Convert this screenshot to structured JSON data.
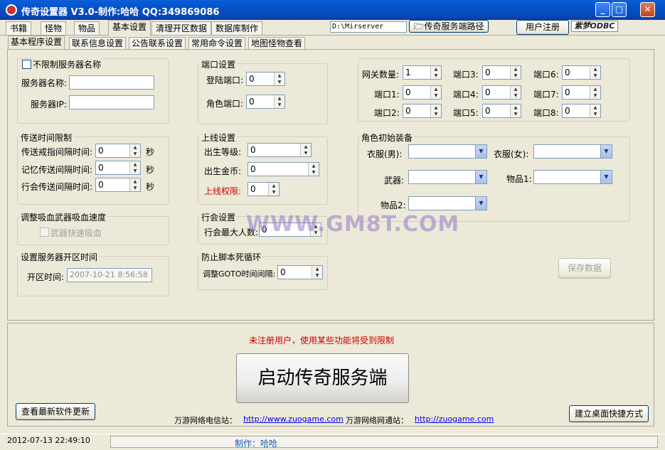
{
  "window": {
    "title": "传奇设置器 V3.0-制作:哈哈 QQ:349869086"
  },
  "top_tabs": [
    "书籍",
    "怪物",
    "物品",
    "基本设置",
    "清理开区数据",
    "数据库制作"
  ],
  "path": {
    "value": "D:\\Mirserver",
    "button": "传奇服务端路径"
  },
  "register_button": "用户注册",
  "logo_text": "紫梦ODBC",
  "sub_tabs": [
    "基本程序设置",
    "联系信息设置",
    "公告联系设置",
    "常用命令设置",
    "地图怪物查看"
  ],
  "server_name": {
    "checkbox": "不限制服务器名称",
    "name_label": "服务器名称:",
    "ip_label": "服务器IP:",
    "name": "",
    "ip": ""
  },
  "ports": {
    "title": "端口设置",
    "login_label": "登陆端口:",
    "login": "0",
    "role_label": "角色端口:",
    "role": "0"
  },
  "gateway": {
    "count_label": "网关数量:",
    "count": "1",
    "ports": [
      {
        "label": "端口1:",
        "value": "0"
      },
      {
        "label": "端口2:",
        "value": "0"
      },
      {
        "label": "端口3:",
        "value": "0"
      },
      {
        "label": "端口4:",
        "value": "0"
      },
      {
        "label": "端口5:",
        "value": "0"
      },
      {
        "label": "端口6:",
        "value": "0"
      },
      {
        "label": "端口7:",
        "value": "0"
      },
      {
        "label": "端口8:",
        "value": "0"
      }
    ]
  },
  "teleport": {
    "title": "传送时间限制",
    "unit": "秒",
    "rows": [
      {
        "label": "传送戒指间隔时间:",
        "value": "0"
      },
      {
        "label": "记忆传送间隔时间:",
        "value": "0"
      },
      {
        "label": "行会传送间隔时间:",
        "value": "0"
      }
    ]
  },
  "online": {
    "title": "上线设置",
    "level_label": "出生等级:",
    "level": "0",
    "gold_label": "出生金币:",
    "gold": "0",
    "perm_label": "上线权限:",
    "perm": "0"
  },
  "equip": {
    "title": "角色初始装备",
    "clothes_m": "衣服(男):",
    "clothes_f": "衣服(女):",
    "weapon": "武器:",
    "item1": "物品1:",
    "item2": "物品2:"
  },
  "vampire": {
    "title": "调整吸血武器吸血速度",
    "checkbox": "武器快速吸血"
  },
  "guild": {
    "title": "行会设置",
    "label": "行会最大人数:",
    "value": "0"
  },
  "open_time": {
    "title": "设置服务器开区时间",
    "label": "开区时间:",
    "value": "2007-10-21  8:56:58"
  },
  "antiloop": {
    "title": "防止脚本死循环",
    "label": "调整GOTO时间间隔:",
    "value": "0"
  },
  "save_button": "保存数据",
  "watermark": "WWW.GM8T.COM",
  "notice": "未注册用户，使用某些功能将受到限制",
  "start_button": "启动传奇服务端",
  "check_update": "查看最新软件更新",
  "desktop_shortcut": "建立桌面快捷方式",
  "telecom": {
    "label": "万游网络电信站：",
    "url": "http://www.zuogame.com"
  },
  "netcom": {
    "label": "万游网络网通站：",
    "url": "http://zuogame.com"
  },
  "status": {
    "datetime": "2012-07-13  22:49:10",
    "maker": "制作：哈哈"
  },
  "colors": {
    "titlebar": "#0a5fd8",
    "notice": "#cc0000",
    "perm_label": "#cc0000",
    "maker": "#1a5fb4"
  }
}
